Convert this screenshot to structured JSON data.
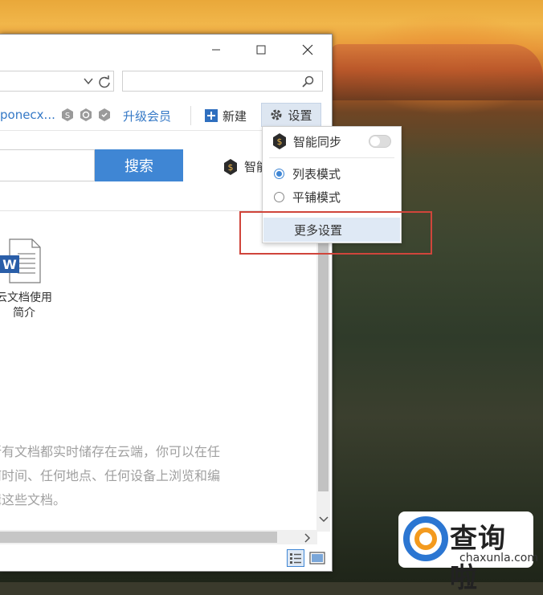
{
  "toolbar": {
    "username": "poneсx...",
    "upgrade_label": "升级会员",
    "new_label": "新建",
    "settings_label": "设置"
  },
  "search": {
    "button_label": "搜索",
    "smart_sync_partial": "智能"
  },
  "settings_menu": {
    "smart_sync_label": "智能同步",
    "smart_sync_on": false,
    "list_mode_label": "列表模式",
    "tile_mode_label": "平铺模式",
    "selected_mode": "list",
    "more_settings_label": "更多设置"
  },
  "file": {
    "name_line1": "云文档使用",
    "name_line2": "简介",
    "icon": "word-document-icon"
  },
  "description": {
    "line1": "所有文档都实时储存在云端，你可以在任",
    "line2": "何时间、任何地点、任何设备上浏览和编",
    "line3": "辑这些文档。"
  },
  "watermark": {
    "title": "查询啦",
    "site": "chaxunla.com"
  },
  "colors": {
    "accent": "#3f86d4",
    "link": "#3478c6",
    "highlight_box": "#d0453b"
  }
}
